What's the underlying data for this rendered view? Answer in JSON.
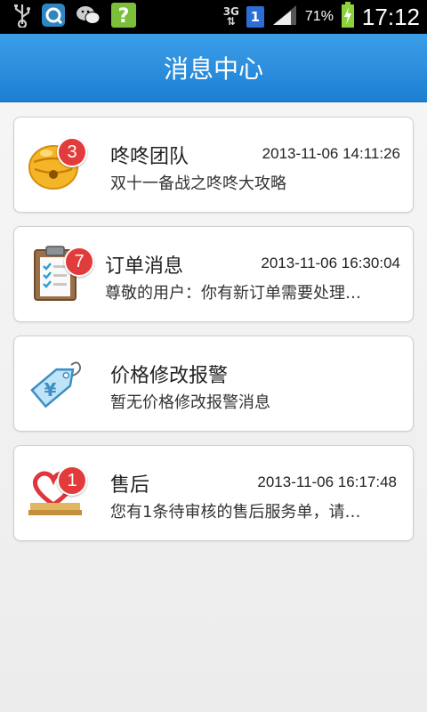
{
  "status_bar": {
    "network": "3G",
    "sim_slot": "1",
    "battery_percent": "71%",
    "time": "17:12",
    "icons": [
      "usb-icon",
      "qq-browser-icon",
      "wechat-icon",
      "help-app-icon",
      "signal-icon",
      "battery-charging-icon"
    ]
  },
  "header": {
    "title": "消息中心"
  },
  "messages": [
    {
      "icon": "bell-icon",
      "badge": "3",
      "title": "咚咚团队",
      "time": "2013-11-06 14:11:26",
      "preview": "双十一备战之咚咚大攻略"
    },
    {
      "icon": "clipboard-icon",
      "badge": "7",
      "title": "订单消息",
      "time": "2013-11-06 16:30:04",
      "preview": "尊敬的用户：你有新订单需要处理…"
    },
    {
      "icon": "price-tag-icon",
      "badge": "",
      "title": "价格修改报警",
      "time": "",
      "preview": "暂无价格修改报警消息"
    },
    {
      "icon": "after-sale-heart-icon",
      "badge": "1",
      "title": "售后",
      "time": "2013-11-06 16:17:48",
      "preview": "您有1条待审核的售后服务单，请…"
    }
  ],
  "colors": {
    "header": "#2a8de0",
    "badge": "#e23b3b"
  }
}
